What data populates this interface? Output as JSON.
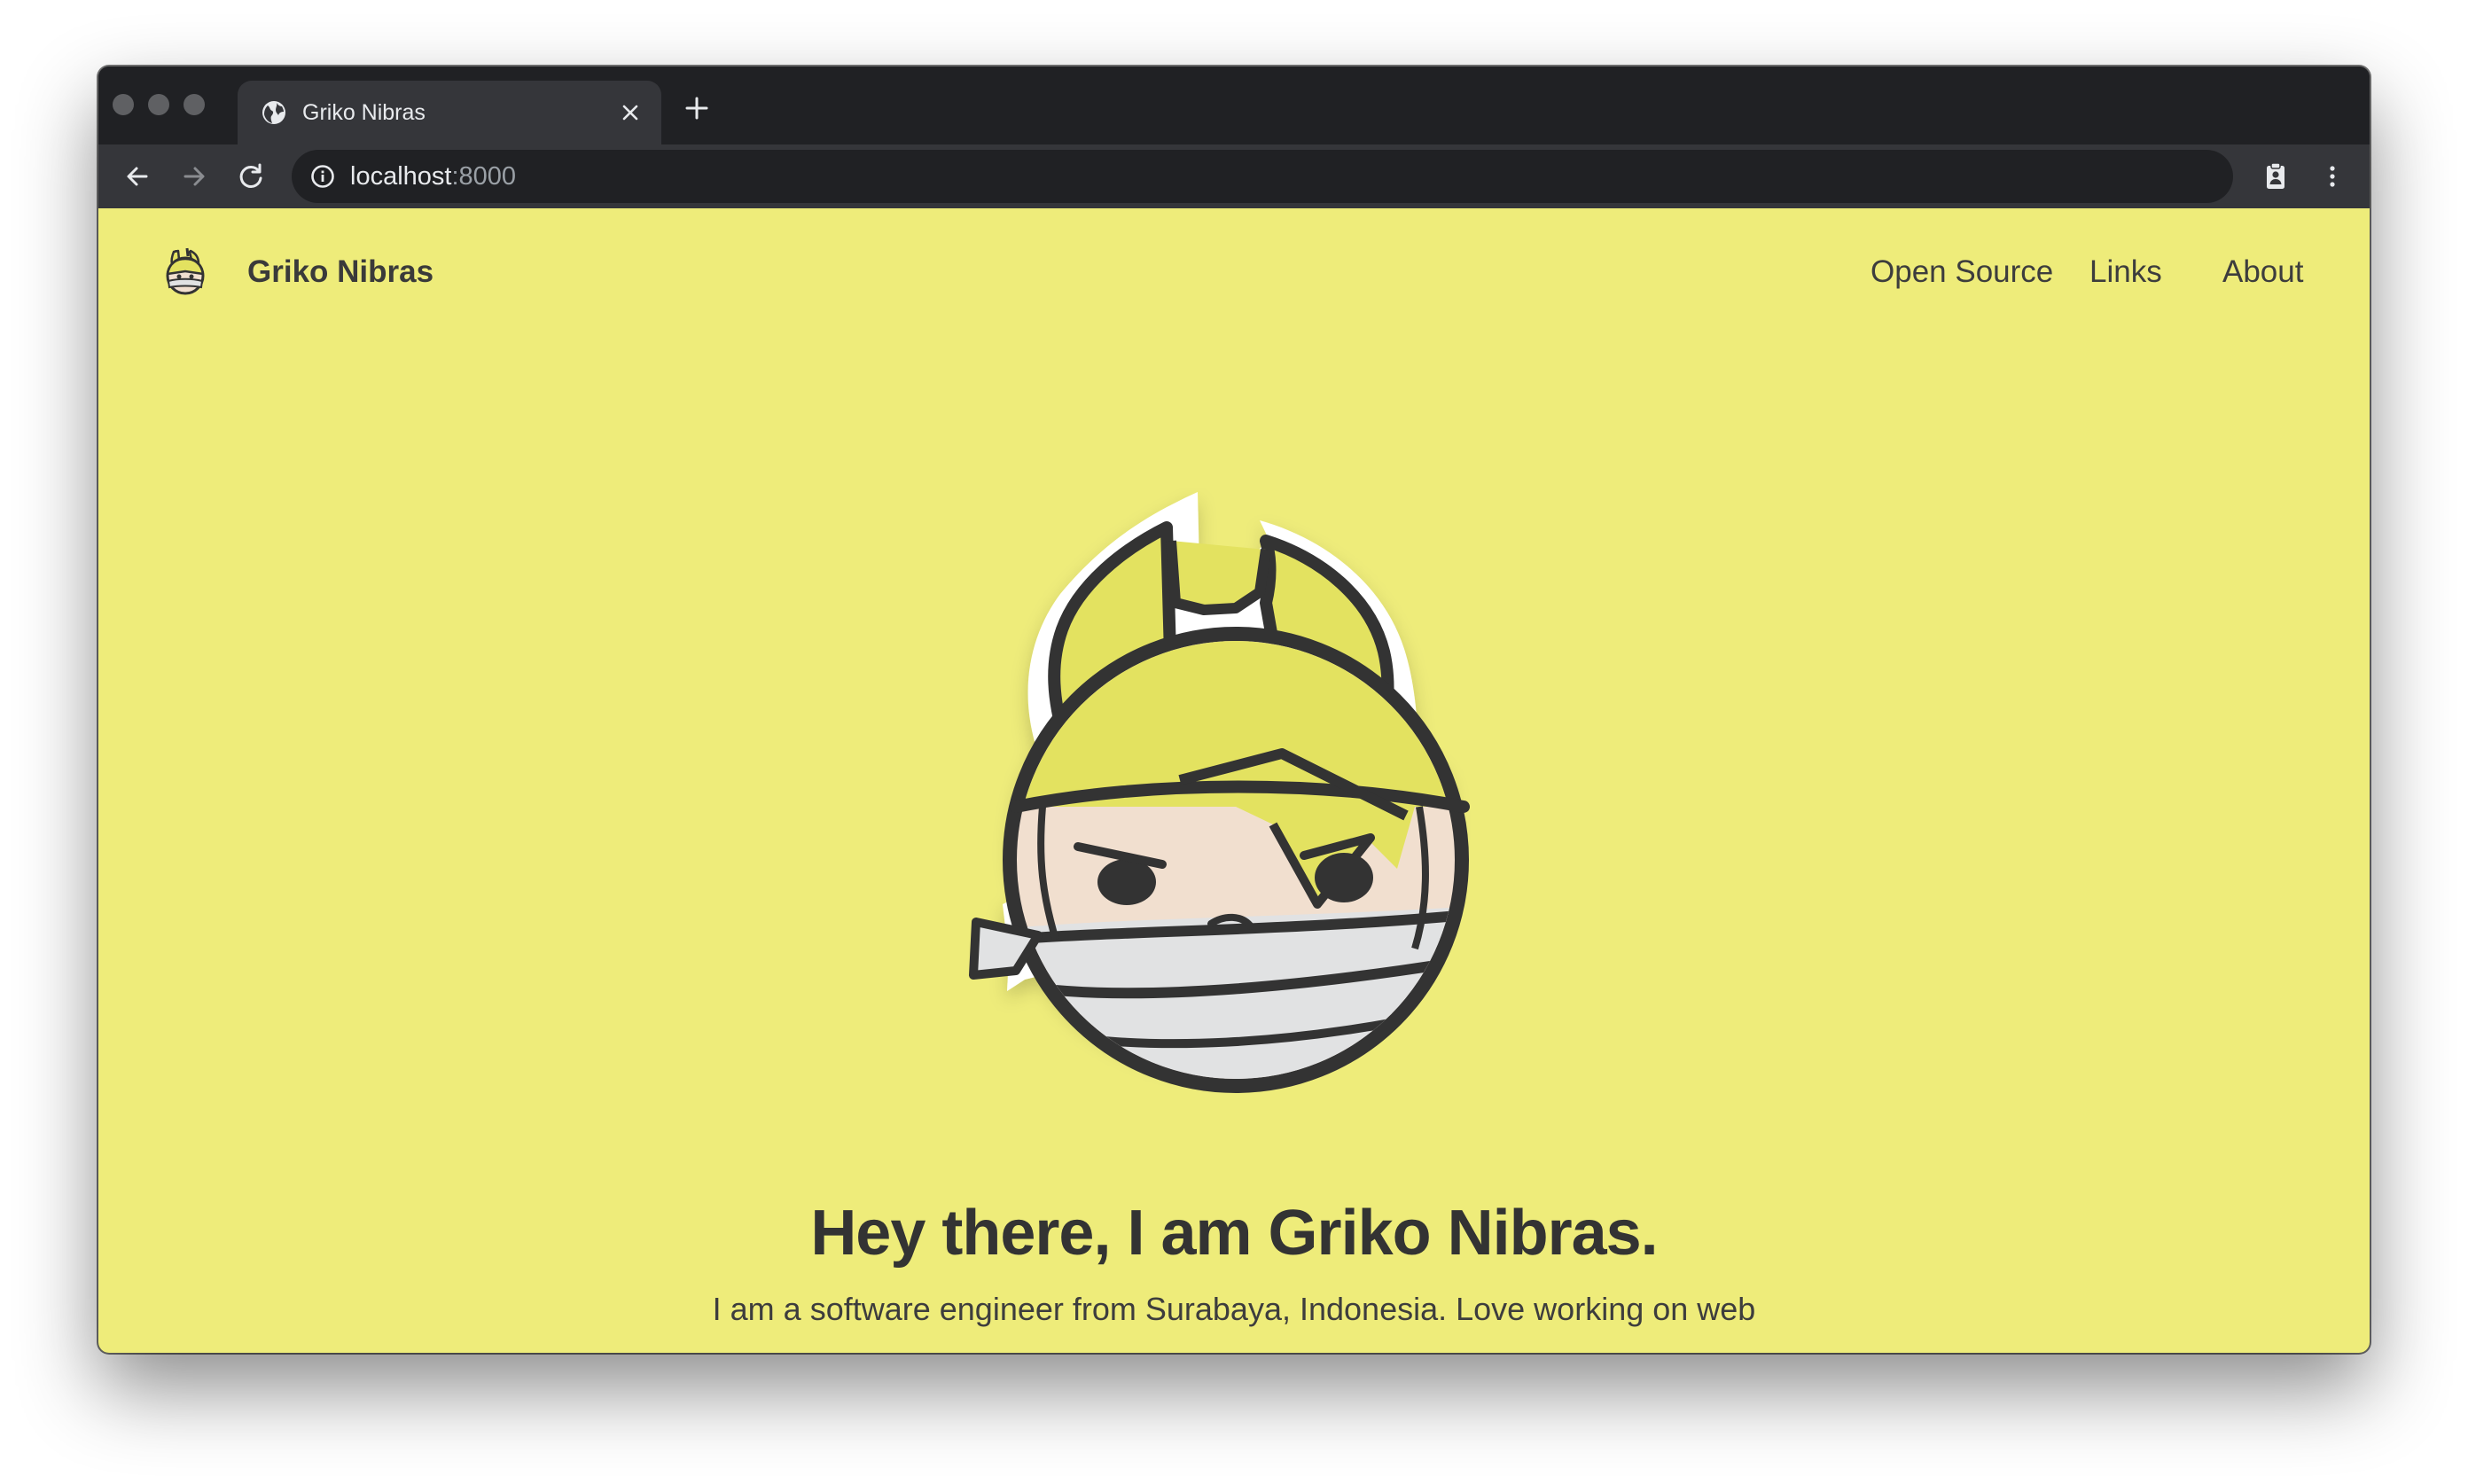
{
  "browser": {
    "tab_title": "Griko Nibras",
    "url_host": "localhost",
    "url_port": ":8000"
  },
  "site": {
    "name": "Griko Nibras",
    "nav": [
      {
        "label": "Open Source"
      },
      {
        "label": "Links"
      },
      {
        "label": "About"
      }
    ]
  },
  "hero": {
    "headline": "Hey there, I am Griko Nibras.",
    "intro": "I am a software engineer from Surabaya, Indonesia. Love working on web"
  },
  "colors": {
    "page_background": "#eeec7a",
    "text": "#333333",
    "browser_frame": "#202124",
    "browser_toolbar": "#35363a"
  },
  "icons": {
    "tab_favicon": "globe-icon",
    "tab_close": "close-icon",
    "new_tab": "plus-icon",
    "back": "arrow-left-icon",
    "forward": "arrow-right-icon",
    "reload": "reload-icon",
    "site_info": "info-icon",
    "profile": "clipboard-profile-icon",
    "menu": "kebab-menu-icon",
    "logo": "ninja-avatar-icon"
  }
}
